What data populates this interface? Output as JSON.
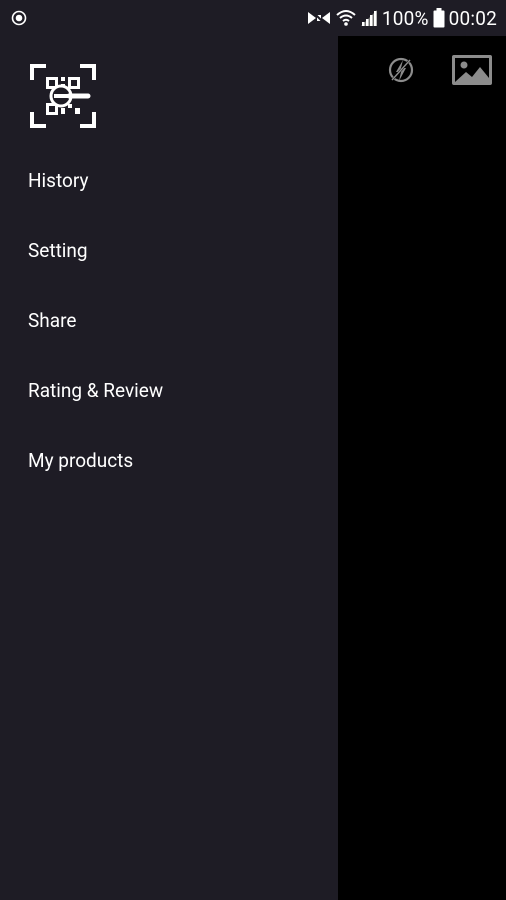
{
  "status_bar": {
    "battery_percent": "100%",
    "time": "00:02",
    "icons": [
      "record-icon",
      "mute-icon",
      "wifi-icon",
      "signal-icon",
      "battery-icon"
    ]
  },
  "toolbar": {
    "icons": [
      "flash-off-icon",
      "gallery-icon"
    ]
  },
  "drawer": {
    "logo": "qr-scanner-logo",
    "menu_items": [
      {
        "label": "History"
      },
      {
        "label": "Setting"
      },
      {
        "label": "Share"
      },
      {
        "label": "Rating & Review"
      },
      {
        "label": "My products"
      }
    ]
  },
  "colors": {
    "drawer_background": "#1e1c25",
    "camera_background": "#000000",
    "text": "#ffffff",
    "toolbar_icon": "#8c8c8c"
  }
}
